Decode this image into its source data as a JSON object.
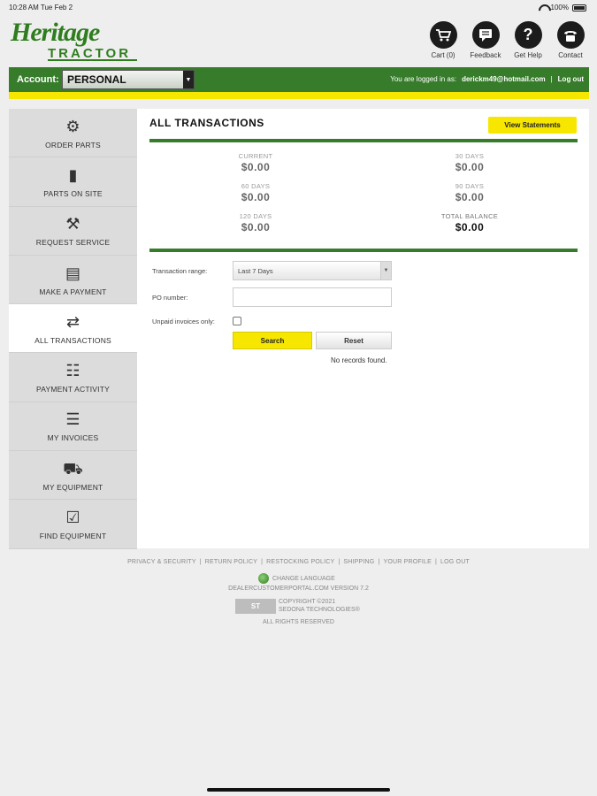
{
  "status_bar": {
    "time": "10:28 AM   Tue Feb 2",
    "battery": "100%"
  },
  "logo": {
    "script": "Heritage",
    "block": "TRACTOR"
  },
  "top_icons": [
    {
      "name": "cart",
      "label": "Cart (0)",
      "glyph": "🛒"
    },
    {
      "name": "feedback",
      "label": "Feedback",
      "glyph": "≡"
    },
    {
      "name": "help",
      "label": "Get Help",
      "glyph": "?"
    },
    {
      "name": "contact",
      "label": "Contact",
      "glyph": "☎"
    }
  ],
  "account_bar": {
    "label": "Account:",
    "selected": "PERSONAL",
    "logged_in_prefix": "You are logged in as:",
    "user": "derickm49@hotmail.com",
    "separator": "|",
    "logout": "Log out"
  },
  "sidebar": {
    "items": [
      {
        "label": "ORDER PARTS",
        "icon": "gears-icon",
        "glyph": "⚙"
      },
      {
        "label": "PARTS ON SITE",
        "icon": "cabinet-icon",
        "glyph": "▮"
      },
      {
        "label": "REQUEST SERVICE",
        "icon": "tools-icon",
        "glyph": "⚒"
      },
      {
        "label": "MAKE A PAYMENT",
        "icon": "credit-card-icon",
        "glyph": "▤"
      },
      {
        "label": "ALL TRANSACTIONS",
        "icon": "transactions-icon",
        "glyph": "⇄",
        "active": true
      },
      {
        "label": "PAYMENT ACTIVITY",
        "icon": "payment-activity-icon",
        "glyph": "☷"
      },
      {
        "label": "MY INVOICES",
        "icon": "invoice-icon",
        "glyph": "☰"
      },
      {
        "label": "MY EQUIPMENT",
        "icon": "tractor-icon",
        "glyph": "⛟"
      },
      {
        "label": "FIND EQUIPMENT",
        "icon": "checkbox-icon",
        "glyph": "☑"
      }
    ]
  },
  "main": {
    "title": "ALL TRANSACTIONS",
    "view_statements": "View Statements",
    "balances": {
      "current": {
        "label": "CURRENT",
        "value": "$0.00"
      },
      "d30": {
        "label": "30 DAYS",
        "value": "$0.00"
      },
      "d60": {
        "label": "60 DAYS",
        "value": "$0.00"
      },
      "d90": {
        "label": "90 DAYS",
        "value": "$0.00"
      },
      "d120": {
        "label": "120 DAYS",
        "value": "$0.00"
      },
      "total": {
        "label": "TOTAL BALANCE",
        "value": "$0.00"
      }
    },
    "form": {
      "range_label": "Transaction range:",
      "range_value": "Last 7 Days",
      "po_label": "PO number:",
      "po_value": "",
      "unpaid_label": "Unpaid invoices only:",
      "search": "Search",
      "reset": "Reset",
      "no_records": "No records found."
    }
  },
  "footer": {
    "links": [
      "PRIVACY & SECURITY",
      "RETURN POLICY",
      "RESTOCKING POLICY",
      "SHIPPING",
      "YOUR PROFILE",
      "LOG OUT"
    ],
    "change_language": "CHANGE LANGUAGE",
    "version": "DEALERCUSTOMERPORTAL.COM VERSION 7.2",
    "copyright_line1": "COPYRIGHT ©2021",
    "copyright_line2": "SEDONA TECHNOLOGIES®",
    "st_logo": "ST",
    "rights": "ALL RIGHTS RESERVED"
  }
}
